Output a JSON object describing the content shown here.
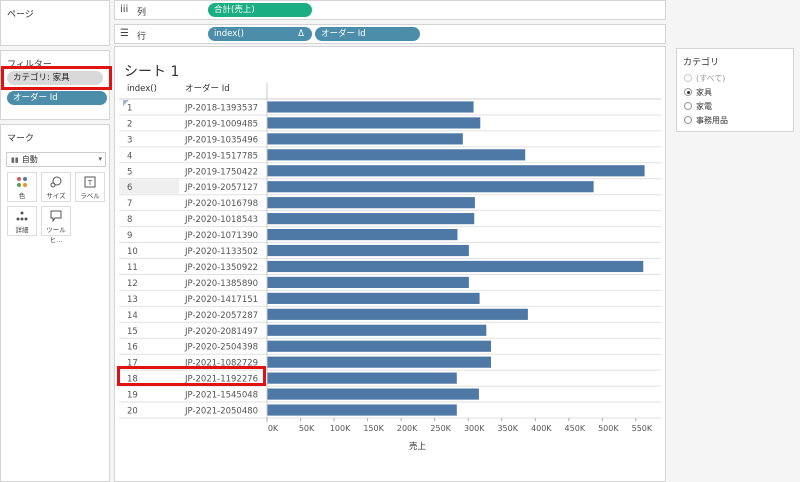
{
  "panels": {
    "pages_title": "ページ",
    "filters_title": "フィルター",
    "marks_title": "マーク"
  },
  "filters": [
    {
      "label": "カテゴリ: 家具"
    },
    {
      "label": "オーダー Id"
    }
  ],
  "marks": {
    "type": "自動",
    "buttons": [
      {
        "label": "色",
        "icon": "color-dots-icon"
      },
      {
        "label": "サイズ",
        "icon": "size-icon"
      },
      {
        "label": "ラベル",
        "icon": "label-icon"
      },
      {
        "label": "詳細",
        "icon": "detail-icon"
      },
      {
        "label": "ツールヒ...",
        "icon": "tooltip-icon"
      }
    ]
  },
  "shelves": {
    "columns_label": "列",
    "rows_label": "行",
    "columns_pills": [
      "合計(売上)"
    ],
    "rows_pills": [
      "index()",
      "オーダー Id"
    ],
    "delta_symbol": "Δ"
  },
  "sheet": {
    "title": "シート 1"
  },
  "table": {
    "col_headers": [
      "index()",
      "オーダー Id"
    ]
  },
  "category_filter": {
    "title": "カテゴリ",
    "options": [
      {
        "label": "(すべて)",
        "selected": false,
        "dim": true
      },
      {
        "label": "家具",
        "selected": true,
        "dim": false
      },
      {
        "label": "家電",
        "selected": false,
        "dim": false
      },
      {
        "label": "事務用品",
        "selected": false,
        "dim": false
      }
    ]
  },
  "colors": {
    "bar": "#4e79a7",
    "highlight": "#e01313",
    "pill_teal": "#4c8eaa",
    "pill_green": "#1bae82"
  },
  "chart_data": {
    "type": "bar",
    "orientation": "horizontal",
    "xlabel": "売上",
    "xlim": [
      0,
      580000
    ],
    "xticks": [
      0,
      50000,
      100000,
      150000,
      200000,
      250000,
      300000,
      350000,
      400000,
      450000,
      500000,
      550000
    ],
    "xtick_labels": [
      "0K",
      "50K",
      "100K",
      "150K",
      "200K",
      "250K",
      "300K",
      "350K",
      "400K",
      "450K",
      "500K",
      "550K"
    ],
    "rows": [
      {
        "index": "1",
        "order_id": "JP-2018-1393537",
        "value": 308000
      },
      {
        "index": "2",
        "order_id": "JP-2019-1009485",
        "value": 318000
      },
      {
        "index": "3",
        "order_id": "JP-2019-1035496",
        "value": 292000
      },
      {
        "index": "4",
        "order_id": "JP-2019-1517785",
        "value": 385000
      },
      {
        "index": "5",
        "order_id": "JP-2019-1750422",
        "value": 563000
      },
      {
        "index": "6",
        "order_id": "JP-2019-2057127",
        "value": 487000
      },
      {
        "index": "7",
        "order_id": "JP-2020-1016798",
        "value": 310000
      },
      {
        "index": "8",
        "order_id": "JP-2020-1018543",
        "value": 309000
      },
      {
        "index": "9",
        "order_id": "JP-2020-1071390",
        "value": 284000
      },
      {
        "index": "10",
        "order_id": "JP-2020-1133502",
        "value": 301000
      },
      {
        "index": "11",
        "order_id": "JP-2020-1350922",
        "value": 561000
      },
      {
        "index": "12",
        "order_id": "JP-2020-1385890",
        "value": 301000
      },
      {
        "index": "13",
        "order_id": "JP-2020-1417151",
        "value": 317000
      },
      {
        "index": "14",
        "order_id": "JP-2020-2057287",
        "value": 389000
      },
      {
        "index": "15",
        "order_id": "JP-2020-2081497",
        "value": 327000
      },
      {
        "index": "16",
        "order_id": "JP-2020-2504398",
        "value": 334000
      },
      {
        "index": "17",
        "order_id": "JP-2021-1082729",
        "value": 334000
      },
      {
        "index": "18",
        "order_id": "JP-2021-1192276",
        "value": 283000
      },
      {
        "index": "19",
        "order_id": "JP-2021-1545048",
        "value": 316000
      },
      {
        "index": "20",
        "order_id": "JP-2021-2050480",
        "value": 283000
      }
    ]
  }
}
